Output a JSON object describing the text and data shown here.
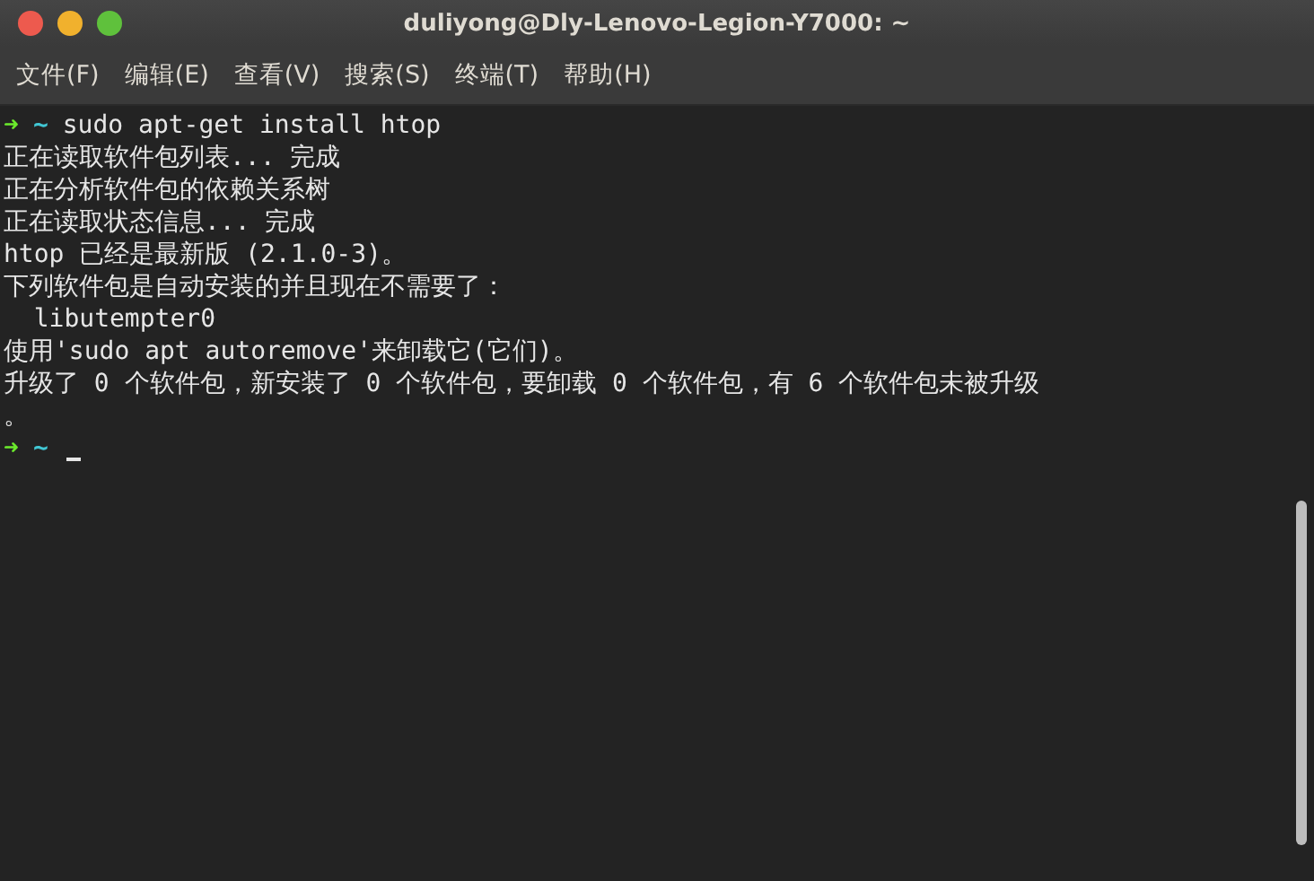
{
  "window": {
    "title": "duliyong@Dly-Lenovo-Legion-Y7000: ~"
  },
  "menu": [
    "文件(F)",
    "编辑(E)",
    "查看(V)",
    "搜索(S)",
    "终端(T)",
    "帮助(H)"
  ],
  "terminal": {
    "lines": [
      {
        "kind": "prompt",
        "arrow": "➜",
        "dir": "~",
        "text": "sudo apt-get install htop"
      },
      {
        "kind": "output",
        "text": "正在读取软件包列表... 完成"
      },
      {
        "kind": "output",
        "text": "正在分析软件包的依赖关系树"
      },
      {
        "kind": "output",
        "text": "正在读取状态信息... 完成"
      },
      {
        "kind": "output",
        "text": "htop 已经是最新版 (2.1.0-3)。"
      },
      {
        "kind": "output",
        "text": "下列软件包是自动安装的并且现在不需要了："
      },
      {
        "kind": "output",
        "text": "  libutempter0"
      },
      {
        "kind": "output",
        "text": "使用'sudo apt autoremove'来卸载它(它们)。"
      },
      {
        "kind": "output",
        "text": "升级了 0 个软件包，新安装了 0 个软件包，要卸载 0 个软件包，有 6 个软件包未被升级"
      },
      {
        "kind": "output",
        "text": "。"
      },
      {
        "kind": "prompt",
        "arrow": "➜",
        "dir": "~",
        "cursor": true
      }
    ]
  }
}
